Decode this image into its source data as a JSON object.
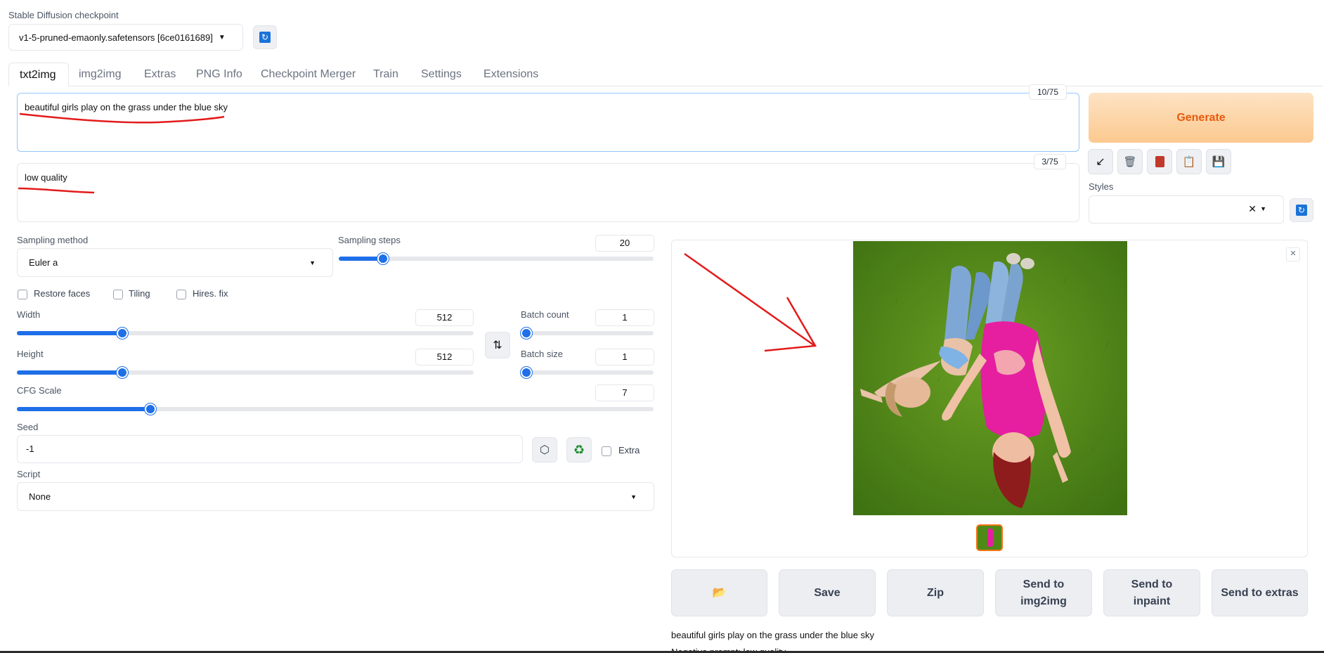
{
  "checkpoint": {
    "label": "Stable Diffusion checkpoint",
    "value": "v1-5-pruned-emaonly.safetensors [6ce0161689]"
  },
  "tabs": [
    "txt2img",
    "img2img",
    "Extras",
    "PNG Info",
    "Checkpoint Merger",
    "Train",
    "Settings",
    "Extensions"
  ],
  "active_tab": "txt2img",
  "prompt": {
    "value": "beautiful girls play on the grass under the blue sky",
    "token_count": "10/75"
  },
  "negative_prompt": {
    "value": "low quality",
    "token_count": "3/75"
  },
  "generate_label": "Generate",
  "styles": {
    "label": "Styles",
    "value": ""
  },
  "sampling": {
    "method_label": "Sampling method",
    "method_value": "Euler a",
    "steps_label": "Sampling steps",
    "steps_value": "20",
    "steps_level": 0.14
  },
  "checkboxes": {
    "restore_faces": "Restore faces",
    "tiling": "Tiling",
    "hires_fix": "Hires. fix",
    "extra": "Extra"
  },
  "width": {
    "label": "Width",
    "value": "512",
    "level": 0.23
  },
  "height": {
    "label": "Height",
    "value": "512",
    "level": 0.23
  },
  "batch_count": {
    "label": "Batch count",
    "value": "1",
    "level": 0
  },
  "batch_size": {
    "label": "Batch size",
    "value": "1",
    "level": 0
  },
  "cfg": {
    "label": "CFG Scale",
    "value": "7",
    "level": 0.21
  },
  "seed": {
    "label": "Seed",
    "value": "-1"
  },
  "script": {
    "label": "Script",
    "value": "None"
  },
  "output": {
    "buttons": {
      "folder": "folder-icon",
      "save": "Save",
      "zip": "Zip",
      "send_img2img": "Send to img2img",
      "send_inpaint": "Send to inpaint",
      "send_extras": "Send to extras"
    },
    "info_line1": "beautiful girls play on the grass under the blue sky",
    "info_line2": "Negative prompt: low quality"
  },
  "colors": {
    "accent": "#1e6fe8",
    "generate_text": "#e8590c",
    "generate_bg": "#fdd9b0",
    "annotation": "#e31b1b"
  }
}
